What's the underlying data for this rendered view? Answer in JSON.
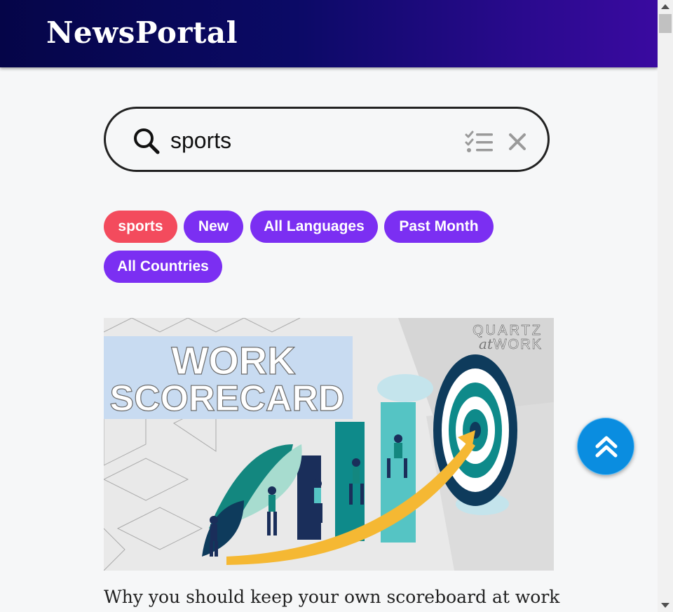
{
  "header": {
    "brand": "NewsPortal"
  },
  "search": {
    "value": "sports",
    "placeholder": ""
  },
  "chips": [
    {
      "label": "sports",
      "kind": "active"
    },
    {
      "label": "New",
      "kind": "filter"
    },
    {
      "label": "All Languages",
      "kind": "filter"
    },
    {
      "label": "Past Month",
      "kind": "filter"
    },
    {
      "label": "All Countries",
      "kind": "filter"
    }
  ],
  "article": {
    "image_text": {
      "headline_top": "WORK",
      "headline_bottom": "SCORECARD",
      "brand_top": "QUARTZ",
      "brand_at": "at",
      "brand_work": "WORK"
    },
    "title": "Why you should keep your own scoreboard at work"
  },
  "colors": {
    "active_chip": "#f34b5d",
    "filter_chip": "#7b2ff2",
    "fab": "#0a8de0"
  },
  "icons": {
    "search": "search-icon",
    "filter": "filter-list-icon",
    "clear": "close-icon",
    "scroll_top": "double-chevron-up-icon"
  }
}
